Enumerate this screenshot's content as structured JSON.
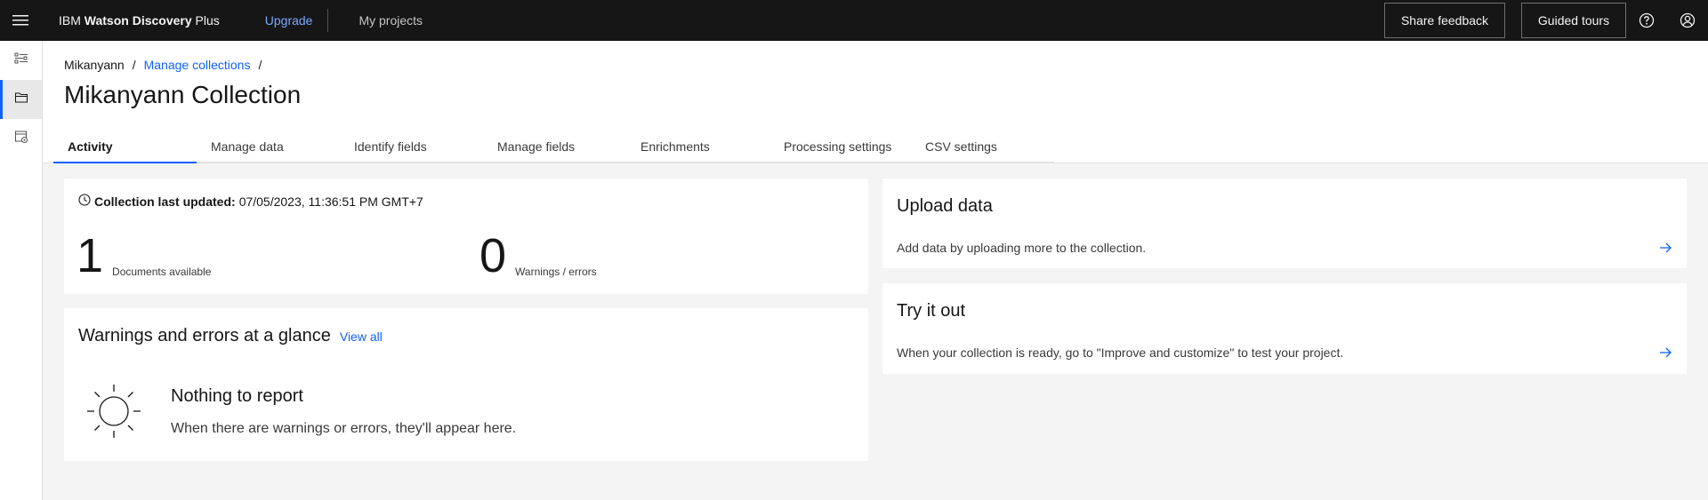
{
  "header": {
    "brand_prefix": "IBM ",
    "brand_bold": "Watson Discovery",
    "brand_suffix": " Plus",
    "upgrade_label": "Upgrade",
    "my_projects_label": "My projects",
    "share_feedback_label": "Share feedback",
    "guided_tours_label": "Guided tours",
    "icons": [
      "menu-icon",
      "help-icon",
      "user-avatar-icon"
    ]
  },
  "siderail": {
    "items": [
      {
        "icon": "settings-adjust-icon",
        "active": false
      },
      {
        "icon": "folder-icon",
        "active": true
      },
      {
        "icon": "data-settings-icon",
        "active": false
      }
    ]
  },
  "breadcrumb": {
    "project": "Mikanyann",
    "sep": "/",
    "collections": "Manage collections",
    "trailing_sep": "/"
  },
  "page": {
    "title": "Mikanyann Collection"
  },
  "tabs": [
    {
      "label": "Activity",
      "active": true
    },
    {
      "label": "Manage data",
      "active": false
    },
    {
      "label": "Identify fields",
      "active": false
    },
    {
      "label": "Manage fields",
      "active": false
    },
    {
      "label": "Enrichments",
      "active": false
    },
    {
      "label": "Processing settings",
      "active": false
    },
    {
      "label": "CSV settings",
      "active": false
    }
  ],
  "status": {
    "updated_label": "Collection last updated:",
    "updated_value": "07/05/2023, 11:36:51 PM GMT+7",
    "documents_count": "1",
    "documents_label": "Documents available",
    "warnings_count": "0",
    "warnings_label": "Warnings / errors"
  },
  "warnings": {
    "title": "Warnings and errors at a glance",
    "view_all": "View all",
    "empty_title": "Nothing to report",
    "empty_message": "When there are warnings or errors, they'll appear here."
  },
  "tiles": {
    "upload": {
      "title": "Upload data",
      "description": "Add data by uploading more to the collection."
    },
    "try": {
      "title": "Try it out",
      "description": "When your collection is ready, go to \"Improve and customize\" to test your project."
    }
  },
  "colors": {
    "header_bg": "#161616",
    "accent": "#0f62fe",
    "upgrade_link": "#78a9ff",
    "page_bg": "#f4f4f4"
  }
}
